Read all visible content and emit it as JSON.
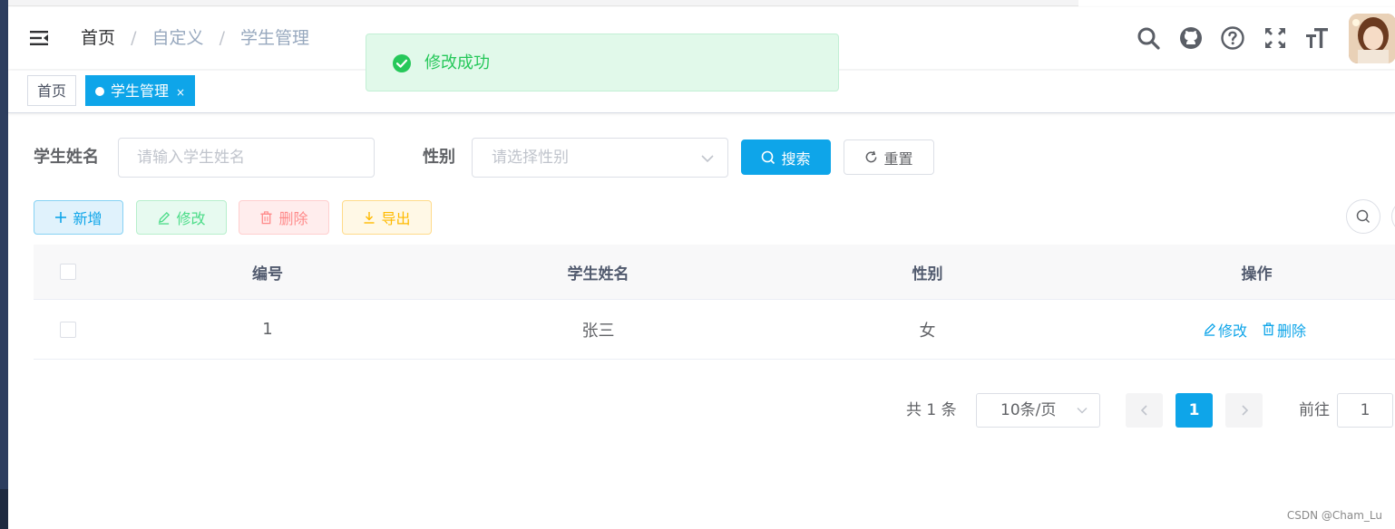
{
  "breadcrumb": {
    "items": [
      "首页",
      "自定义",
      "学生管理"
    ],
    "separator": "/"
  },
  "toast": {
    "message": "修改成功"
  },
  "tags": {
    "home": "首页",
    "active": "学生管理",
    "close": "×"
  },
  "search_form": {
    "name_label": "学生姓名",
    "name_placeholder": "请输入学生姓名",
    "gender_label": "性别",
    "gender_placeholder": "请选择性别",
    "search_button": "搜索",
    "reset_button": "重置"
  },
  "toolbar": {
    "add": "新增",
    "edit": "修改",
    "delete": "删除",
    "export": "导出"
  },
  "table": {
    "columns": [
      "编号",
      "学生姓名",
      "性别",
      "操作"
    ],
    "rows": [
      {
        "id": "1",
        "name": "张三",
        "gender": "女",
        "edit": "修改",
        "delete": "删除"
      }
    ]
  },
  "pagination": {
    "total_text": "共 1 条",
    "page_size": "10条/页",
    "current_page": "1",
    "jump_label": "前往",
    "jump_value": "1"
  },
  "watermark": "CSDN @Cham_Lu",
  "colors": {
    "primary": "#0ea5e9",
    "success": "#26c85a",
    "sidebar": "#2d3e5f"
  },
  "icons": [
    "hamburger-icon",
    "search-icon",
    "github-icon",
    "help-icon",
    "fullscreen-icon",
    "font-size-icon",
    "check-circle-icon",
    "plus-icon",
    "edit-icon",
    "delete-icon",
    "download-icon",
    "refresh-icon",
    "chevron-down-icon"
  ]
}
